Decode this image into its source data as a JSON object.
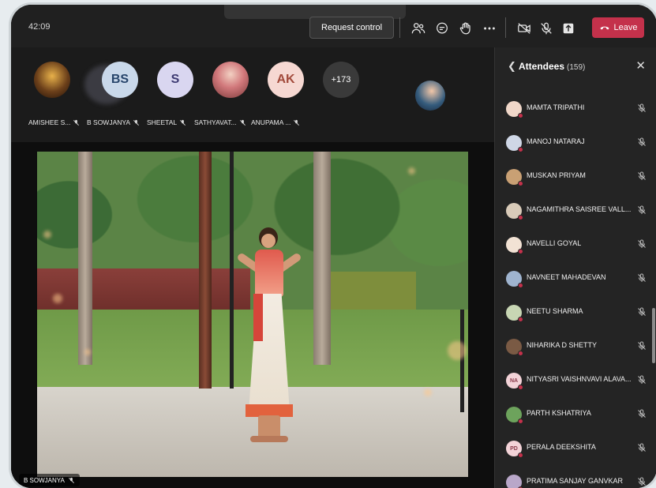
{
  "meeting": {
    "timer": "42:09",
    "request_control_label": "Request control",
    "leave_label": "Leave"
  },
  "toolbar_icons": [
    "people-icon",
    "chat-icon",
    "raise-hand-icon",
    "more-icon",
    "camera-off-icon",
    "mic-off-icon",
    "share-icon",
    "leave-phone-icon"
  ],
  "participants": [
    {
      "name": "AMISHEE S...",
      "initials": "",
      "muted": true
    },
    {
      "name": "B SOWJANYA",
      "initials": "BS",
      "muted": true
    },
    {
      "name": "SHEETAL",
      "initials": "S",
      "muted": true
    },
    {
      "name": "SATHYAVAT...",
      "initials": "",
      "muted": true
    },
    {
      "name": "ANUPAMA ...",
      "initials": "AK",
      "muted": true
    }
  ],
  "more_participants": "+173",
  "main_video": {
    "label": "B SOWJANYA"
  },
  "attendees_panel": {
    "title": "Attendees",
    "count": "(159)",
    "attendees": [
      {
        "name": "MAMTA TRIPATHI",
        "initials": "",
        "avatar_color": "#f0d7c9"
      },
      {
        "name": "MANOJ NATARAJ",
        "initials": "",
        "avatar_color": "#cfd7e6"
      },
      {
        "name": "MUSKAN PRIYAM",
        "initials": "",
        "avatar_color": "#c9a074"
      },
      {
        "name": "NAGAMITHRA SAISREE VALL...",
        "initials": "",
        "avatar_color": "#d9cbb9"
      },
      {
        "name": "NAVELLI GOYAL",
        "initials": "",
        "avatar_color": "#f2e2d4"
      },
      {
        "name": "NAVNEET MAHADEVAN",
        "initials": "",
        "avatar_color": "#9fb4cf"
      },
      {
        "name": "NEETU SHARMA",
        "initials": "",
        "avatar_color": "#c8d6b4"
      },
      {
        "name": "NIHARIKA D SHETTY",
        "initials": "",
        "avatar_color": "#7a5a44"
      },
      {
        "name": "NITYASRI VAISHNVAVI ALAVA...",
        "initials": "NA",
        "avatar_color": "#f3d3d8"
      },
      {
        "name": "PARTH KSHATRIYA",
        "initials": "",
        "avatar_color": "#6da35c"
      },
      {
        "name": "PERALA DEEKSHITA",
        "initials": "PD",
        "avatar_color": "#f3d3d8"
      },
      {
        "name": "PRATIMA SANJAY GANVKAR",
        "initials": "",
        "avatar_color": "#b9a7c9"
      }
    ]
  }
}
